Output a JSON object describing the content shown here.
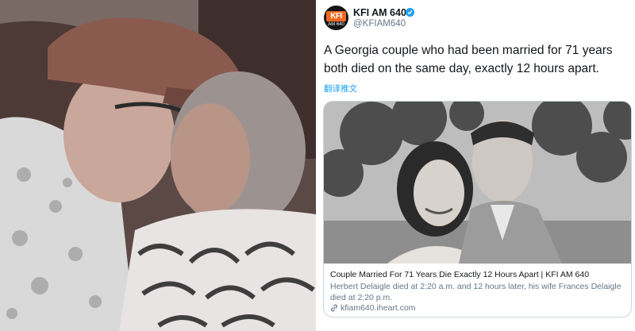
{
  "account": {
    "avatar_text": "KFI",
    "avatar_subtext": "AM 640",
    "display_name": "KFI AM 640",
    "handle": "@KFIAM640",
    "verified_icon": "verified-badge-icon",
    "brand_color": "#f26a22",
    "verified_color": "#1da1f2"
  },
  "tweet": {
    "text": "A Georgia couple who had been married for 71 years both died on the same day, exactly 12 hours apart.",
    "translate_label": "翻译推文"
  },
  "card": {
    "title": "Couple Married For 71 Years Die Exactly 12 Hours Apart | KFI AM 640",
    "description": "Herbert Delaigle died at 2:20 a.m. and 12 hours later, his wife Frances Delaigle died at 2:20 p.m.",
    "link_icon": "link-icon",
    "domain": "kfiam640.iheart.com"
  }
}
